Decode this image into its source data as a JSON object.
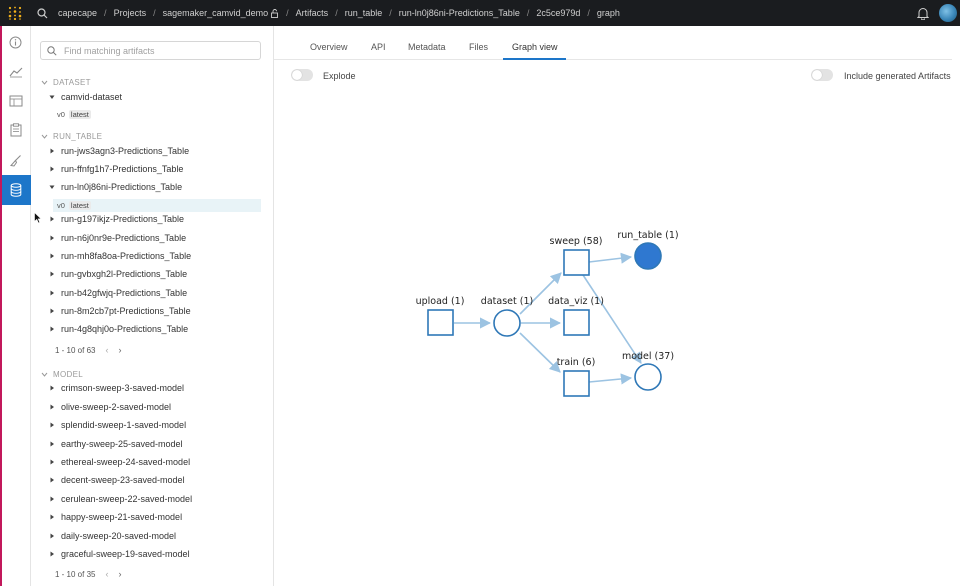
{
  "breadcrumb": {
    "items": [
      "capecape",
      "Projects",
      "sagemaker_camvid_demo",
      "Artifacts",
      "run_table",
      "run-ln0j86ni-Predictions_Table",
      "2c5ce979d",
      "graph"
    ]
  },
  "sidebar": {
    "search_placeholder": "Find matching artifacts",
    "sections": {
      "dataset": {
        "title": "DATASET",
        "items": [
          "camvid-dataset"
        ],
        "version": "v0",
        "version_tag": "latest"
      },
      "run_table": {
        "title": "RUN_TABLE",
        "items": [
          "run-jws3agn3-Predictions_Table",
          "run-ffnfg1h7-Predictions_Table",
          "run-ln0j86ni-Predictions_Table",
          "run-g197ikjz-Predictions_Table",
          "run-n6j0nr9e-Predictions_Table",
          "run-mh8fa8oa-Predictions_Table",
          "run-gvbxgh2l-Predictions_Table",
          "run-b42gfwjq-Predictions_Table",
          "run-8m2cb7pt-Predictions_Table",
          "run-4g8qhj0o-Predictions_Table"
        ],
        "version": "v0",
        "version_tag": "latest",
        "pagination": "1 - 10 of 63"
      },
      "model": {
        "title": "MODEL",
        "items": [
          "crimson-sweep-3-saved-model",
          "olive-sweep-2-saved-model",
          "splendid-sweep-1-saved-model",
          "earthy-sweep-25-saved-model",
          "ethereal-sweep-24-saved-model",
          "decent-sweep-23-saved-model",
          "cerulean-sweep-22-saved-model",
          "happy-sweep-21-saved-model",
          "daily-sweep-20-saved-model",
          "graceful-sweep-19-saved-model"
        ],
        "pagination": "1 - 10 of 35"
      }
    }
  },
  "main": {
    "tabs": [
      "Overview",
      "API",
      "Metadata",
      "Files",
      "Graph view"
    ],
    "active_tab": "Graph view",
    "explode_label": "Explode",
    "include_generated_label": "Include generated Artifacts"
  },
  "graph": {
    "nodes": {
      "upload": "upload (1)",
      "dataset": "dataset (1)",
      "sweep": "sweep (58)",
      "data_viz": "data_viz (1)",
      "train": "train (6)",
      "run_table": "run_table (1)",
      "model": "model (37)"
    }
  },
  "colors": {
    "accent": "#1d76c9",
    "node_stroke": "#2f78b7",
    "edge": "#9cc3e2",
    "topbar": "#1a1c1f"
  }
}
